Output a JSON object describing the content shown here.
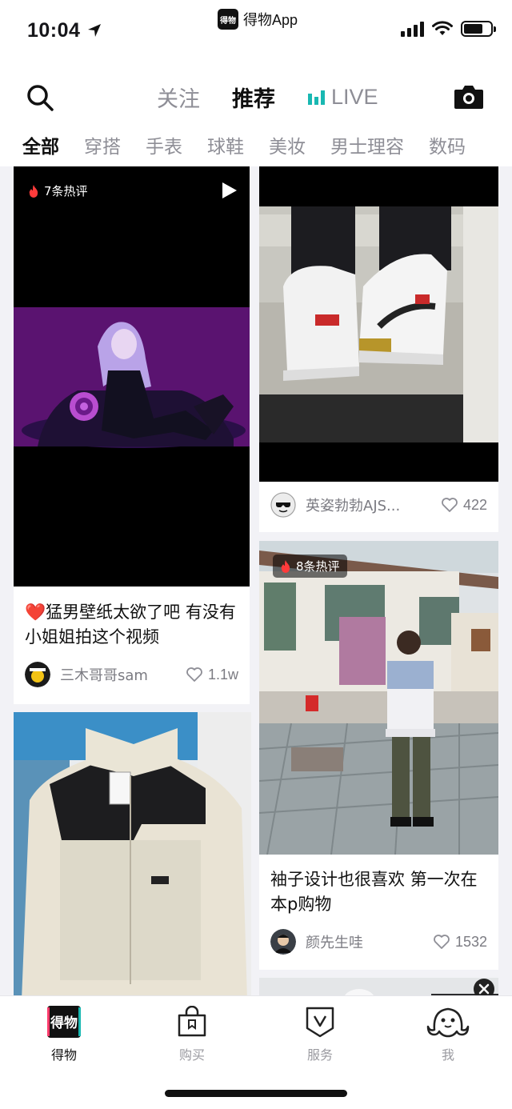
{
  "status_bar": {
    "time": "10:04",
    "app_name": "得物App",
    "app_logo_text": "得物"
  },
  "top_nav": {
    "tabs": [
      {
        "label": "关注",
        "active": false
      },
      {
        "label": "推荐",
        "active": true
      },
      {
        "label": "LIVE",
        "active": false
      }
    ],
    "search_icon": "search-icon",
    "camera_icon": "camera-icon"
  },
  "categories": [
    "全部",
    "穿搭",
    "手表",
    "球鞋",
    "美妆",
    "男士理容",
    "数码"
  ],
  "feed": {
    "cards": [
      {
        "id": "card-1",
        "badge": "7条热评",
        "has_video": true,
        "title": "❤️猛男壁纸太欲了吧 有没有小姐姐拍这个视频",
        "author": "三木哥哥sam",
        "likes": "1.1w"
      },
      {
        "id": "card-2",
        "badge": "",
        "has_video": false,
        "title": "",
        "author": "英姿勃勃AJS...",
        "likes": "422"
      },
      {
        "id": "card-3",
        "badge": "8条热评",
        "has_video": false,
        "title": "袖子设计也很喜欢 第一次在本p购物",
        "author": "颜先生哇",
        "likes": "1532"
      },
      {
        "id": "card-4",
        "badge": "",
        "has_video": false,
        "title": "",
        "author": "",
        "likes": ""
      }
    ]
  },
  "tab_bar": {
    "items": [
      {
        "label": "得物",
        "icon": "dewu-logo-icon",
        "active": true
      },
      {
        "label": "购买",
        "icon": "shopping-bag-icon",
        "active": false
      },
      {
        "label": "服务",
        "icon": "shield-v-icon",
        "active": false
      },
      {
        "label": "我",
        "icon": "ghost-profile-icon",
        "active": false
      }
    ],
    "logo_text": "得物"
  },
  "colors": {
    "accent_live": "#19b8b2",
    "flame": "#ff3b3b",
    "heart_red": "#e53935",
    "text_primary": "#111111",
    "text_secondary": "#8e8e96"
  }
}
